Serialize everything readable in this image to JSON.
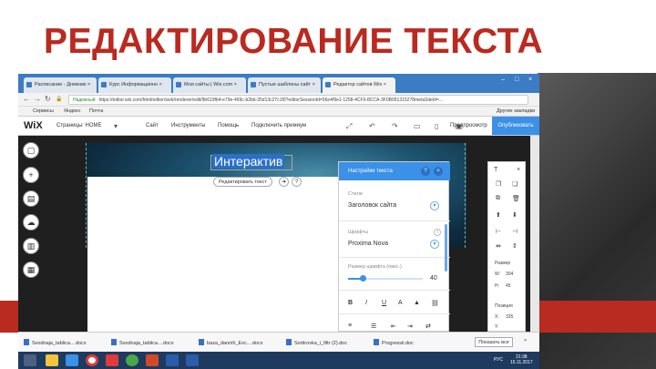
{
  "slide": {
    "title": "РЕДАКТИРОВАНИЕ ТЕКСТА"
  },
  "browser": {
    "tabs": [
      {
        "label": "Расписание - Дневник ×"
      },
      {
        "label": "Курс Информационн ×"
      },
      {
        "label": "Мои сайты | Wix.com ×"
      },
      {
        "label": "Пустые шаблоны сайт ×"
      },
      {
        "label": "Редактор сайтов Wix ×"
      }
    ],
    "window_controls": [
      "–",
      "□",
      "×"
    ],
    "address": {
      "secure_label": "Надежный",
      "url": "https://editor.wix.com/html/editor/web/renderer/edit/9b619fb4-e79e-469c-b2bb-35d13c27c1f0?editorSessionId=56e4f9e1-1258-4CF0-8CCA-3F0B051315278metaSiteId=..."
    },
    "bookmarks": {
      "apps": "Сервисы",
      "items": [
        "Яндекс",
        "Почта"
      ],
      "other": "Другие закладки"
    }
  },
  "wix": {
    "logo": "WiX",
    "pages_label": "Страницы: HOME",
    "menu": [
      "Сайт",
      "Инструменты",
      "Помощь",
      "Подключить премиум"
    ],
    "preview_label": "Предпросмотр",
    "publish_label": "Опубликовать"
  },
  "editor": {
    "heading_text": "Интерактив",
    "edit_text_button": "Редактировать текст",
    "panel": {
      "title": "Настройки текста",
      "help": "?",
      "close": "×",
      "styles_label": "Стили",
      "styles_value": "Заголовок сайта",
      "fonts_label": "Шрифты",
      "fonts_value": "Proxima Nova",
      "size_label": "Размер шрифта (пикс.)",
      "size_value": "40",
      "size_fraction": 0.2
    },
    "toolbox": {
      "arrange_label": "Размер",
      "w_label": "W:",
      "w_value": "304",
      "h_label": "H:",
      "h_value": "45",
      "position_label": "Позиция",
      "x_label": "X:",
      "x_value": "335",
      "y_label": "Y:",
      "y_value": ""
    }
  },
  "downloads": {
    "items": [
      "Svodnaja_tablica....docx",
      "Svodnaja_tablica....docx",
      "baza_dannih_Exc....docx",
      "Sortirovka_i_filtr (2).doc",
      "Progressii.doc"
    ],
    "show_all": "Показать все"
  },
  "taskbar": {
    "lang": "РУС",
    "time": "21:38",
    "date": "15.11.2017"
  }
}
